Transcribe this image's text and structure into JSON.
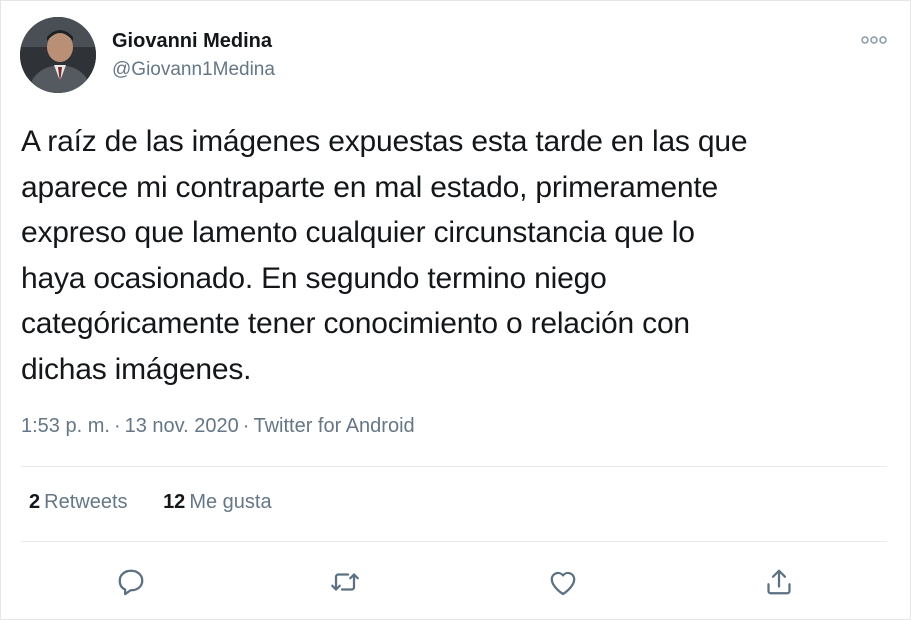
{
  "author": {
    "display_name": "Giovanni Medina",
    "handle": "@Giovann1Medina",
    "avatar_icon": "user-avatar"
  },
  "header": {
    "more_icon": "more-options-icon"
  },
  "tweet": {
    "text": "A raíz de las imágenes expuestas esta tarde en las que\naparece mi contraparte en mal estado, primeramente\nexpreso que lamento cualquier circunstancia que lo\nhaya ocasionado. En segundo termino niego\ncategóricamente tener conocimiento o relación con\ndichas imágenes."
  },
  "meta": {
    "time": "1:53 p. m.",
    "separator": "·",
    "date": "13 nov. 2020",
    "source": "Twitter for Android"
  },
  "stats": {
    "retweets_count": "2",
    "retweets_label": "Retweets",
    "likes_count": "12",
    "likes_label": "Me gusta"
  },
  "actions": [
    {
      "icon": "reply-icon"
    },
    {
      "icon": "retweet-icon"
    },
    {
      "icon": "like-icon"
    },
    {
      "icon": "share-icon"
    }
  ],
  "colors": {
    "primary_text": "#14171a",
    "secondary_text": "#657786",
    "divider": "#e6ecf0",
    "icon": "#5b7083"
  }
}
